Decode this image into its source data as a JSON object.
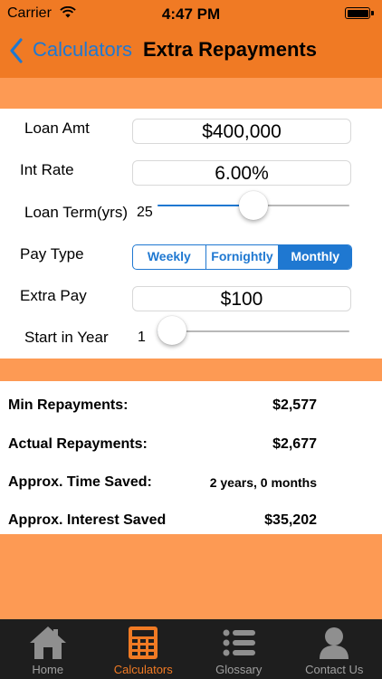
{
  "status_bar": {
    "carrier": "Carrier",
    "time": "4:47 PM"
  },
  "nav": {
    "back_label": "Calculators",
    "title": "Extra Repayments"
  },
  "form": {
    "loan_amount": {
      "label": "Loan Amt",
      "value": "$400,000"
    },
    "interest_rate": {
      "label": "Int Rate",
      "value": "6.00%"
    },
    "loan_term": {
      "label": "Loan Term(yrs)",
      "value": "25",
      "slider_fraction": 0.5
    },
    "pay_type": {
      "label": "Pay Type",
      "options": [
        "Weekly",
        "Fornightly",
        "Monthly"
      ],
      "selected": "Monthly"
    },
    "extra_pay": {
      "label": "Extra Pay",
      "value": "$100"
    },
    "start_year": {
      "label": "Start in Year",
      "value": "1",
      "slider_fraction": 0.0
    }
  },
  "results": [
    {
      "label": "Min Repayments:",
      "value": "$2,577"
    },
    {
      "label": "Actual Repayments:",
      "value": "$2,677"
    },
    {
      "label": "Approx. Time Saved:",
      "value": "2 years, 0 months"
    },
    {
      "label": "Approx. Interest Saved",
      "value": "$35,202"
    }
  ],
  "tabs": [
    {
      "label": "Home",
      "icon": "home-icon"
    },
    {
      "label": "Calculators",
      "icon": "calculator-icon",
      "active": true
    },
    {
      "label": "Glossary",
      "icon": "list-icon"
    },
    {
      "label": "Contact Us",
      "icon": "person-icon"
    }
  ],
  "colors": {
    "header": "#f07a24",
    "band": "#fd9a54",
    "accent_blue": "#1f78d1",
    "tabbar": "#1e1e1e",
    "tab_active": "#f07a24"
  }
}
